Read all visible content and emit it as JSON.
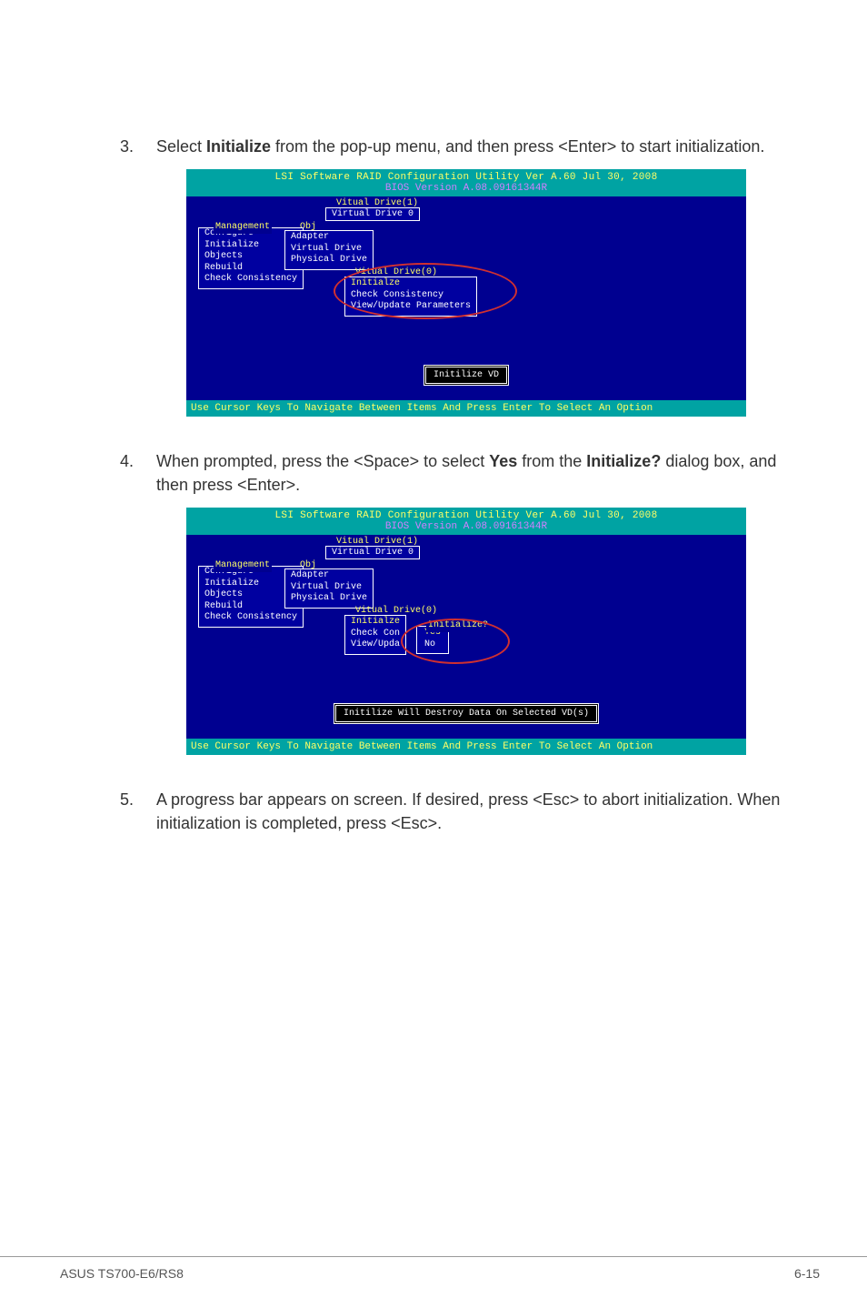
{
  "steps": {
    "s3": {
      "num": "3.",
      "p1_a": "Select ",
      "p1_bold": "Initialize",
      "p1_b": " from the pop-up menu, and then press <Enter> to start initialization."
    },
    "s4": {
      "num": "4.",
      "p1_a": "When prompted, press the <Space> to select ",
      "p1_bold1": "Yes",
      "p1_b": " from the ",
      "p1_bold2": "Initialize?",
      "p1_c": " dialog box, and then press <Enter>."
    },
    "s5": {
      "num": "5.",
      "p1": "A progress bar appears on screen. If desired, press <Esc> to abort initialization. When initialization is completed, press <Esc>."
    }
  },
  "bios": {
    "header1": "LSI Software RAID Configuration Utility Ver A.60 Jul 30, 2008",
    "header2": "BIOS Version  A.08.09161344R",
    "vd1": "Vitual Drive(1)",
    "vd0": "Virtual Drive 0",
    "obj": "Obj",
    "mgmt_label": "Management",
    "mgmt": {
      "i0": "Configure",
      "i1": "Initialize",
      "i2": "Objects",
      "i3": "Rebuild",
      "i4": "Check Consistency"
    },
    "adapter_menu": {
      "a0": "Adapter",
      "a1": "Virtual Drive",
      "a2": "Physical Drive"
    },
    "sub_drive": "Vitual Drive(0)",
    "init_menu": {
      "m0": "Initialze",
      "m1": "Check Consistency",
      "m2": "View/Update Parameters"
    },
    "init_menu2": {
      "m0": "Initialze",
      "m1": "Check Con",
      "m2": "View/Upda"
    },
    "init_q_label": "Initialize?",
    "init_q_yes": "Yes",
    "init_q_no": "No",
    "status1": "Initilize VD",
    "status2": "Initilize Will Destroy Data On Selected VD(s)",
    "footer": "Use Cursor Keys To Navigate Between Items And Press Enter To Select An Option"
  },
  "page_footer": {
    "left": "ASUS TS700-E6/RS8",
    "right": "6-15"
  }
}
